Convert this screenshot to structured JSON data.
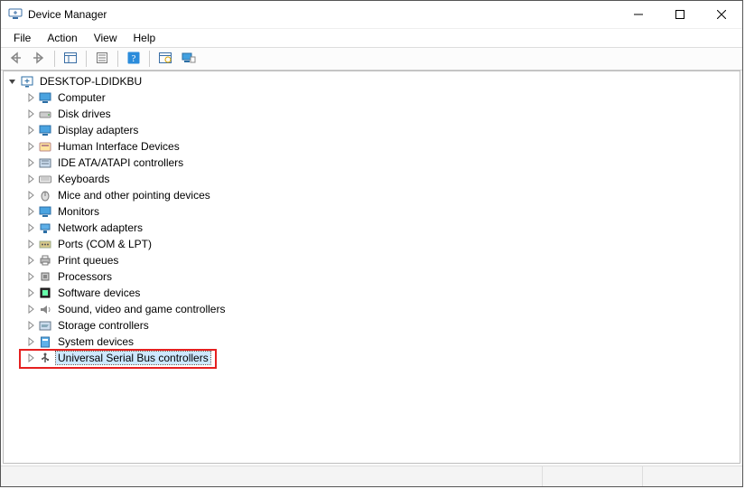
{
  "window": {
    "title": "Device Manager"
  },
  "menu": {
    "file": "File",
    "action": "Action",
    "view": "View",
    "help": "Help"
  },
  "tree": {
    "root": {
      "label": "DESKTOP-LDIDKBU",
      "expanded": true
    },
    "items": [
      {
        "label": "Computer",
        "icon": "monitor"
      },
      {
        "label": "Disk drives",
        "icon": "disk"
      },
      {
        "label": "Display adapters",
        "icon": "monitor"
      },
      {
        "label": "Human Interface Devices",
        "icon": "hid"
      },
      {
        "label": "IDE ATA/ATAPI controllers",
        "icon": "ide"
      },
      {
        "label": "Keyboards",
        "icon": "keyboard"
      },
      {
        "label": "Mice and other pointing devices",
        "icon": "mouse"
      },
      {
        "label": "Monitors",
        "icon": "monitor"
      },
      {
        "label": "Network adapters",
        "icon": "network"
      },
      {
        "label": "Ports (COM & LPT)",
        "icon": "port"
      },
      {
        "label": "Print queues",
        "icon": "printer"
      },
      {
        "label": "Processors",
        "icon": "cpu"
      },
      {
        "label": "Software devices",
        "icon": "software"
      },
      {
        "label": "Sound, video and game controllers",
        "icon": "sound"
      },
      {
        "label": "Storage controllers",
        "icon": "storage"
      },
      {
        "label": "System devices",
        "icon": "system"
      },
      {
        "label": "Universal Serial Bus controllers",
        "icon": "usb",
        "selected": true,
        "highlighted": true
      }
    ]
  },
  "highlight_color": "#e52020",
  "selection_color": "#cde8ff"
}
